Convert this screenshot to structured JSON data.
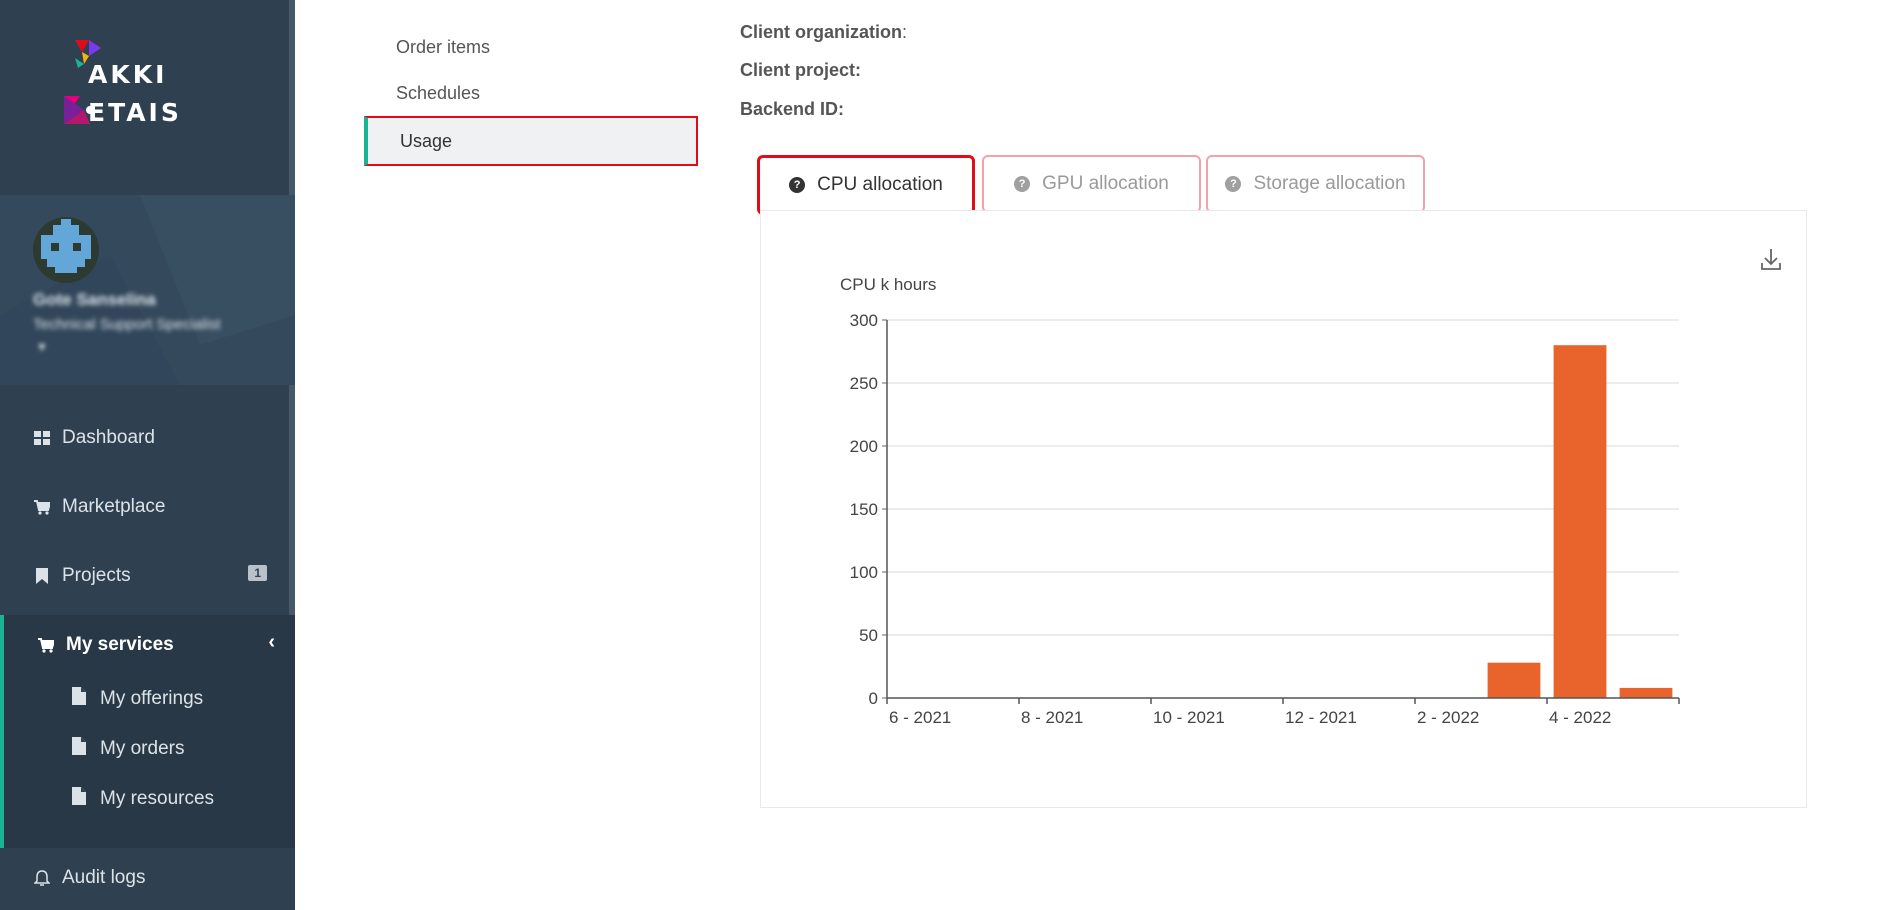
{
  "sidebar": {
    "brand": {
      "line1": "AKKI",
      "line2": "ETAIS"
    },
    "user": {
      "name": "Gote Sanselina",
      "role": "Technical Support Specialist"
    },
    "nav": [
      {
        "label": "Dashboard",
        "icon": "dashboard-icon"
      },
      {
        "label": "Marketplace",
        "icon": "cart-icon"
      },
      {
        "label": "Projects",
        "icon": "bookmark-icon",
        "badge": "1"
      },
      {
        "label": "My services",
        "icon": "cart-icon",
        "chevron": "‹"
      }
    ],
    "subnav": [
      {
        "label": "My offerings",
        "icon": "file-icon"
      },
      {
        "label": "My orders",
        "icon": "file-icon"
      },
      {
        "label": "My resources",
        "icon": "file-icon"
      }
    ],
    "audit": {
      "label": "Audit logs",
      "icon": "bell-icon"
    }
  },
  "details_tabs": [
    {
      "label": "Order items"
    },
    {
      "label": "Schedules"
    },
    {
      "label": "Usage"
    }
  ],
  "info": {
    "client_org": "Client organization",
    "client_project": "Client project:",
    "backend_id": "Backend ID:"
  },
  "usage_tabs": {
    "cpu": "CPU allocation",
    "gpu": "GPU allocation",
    "storage": "Storage allocation"
  },
  "colors": {
    "bar": "#e8642c",
    "accent": "#1ab394",
    "highlight": "#e30b17",
    "sidebar": "#2f4050"
  },
  "chart_data": {
    "type": "bar",
    "ylabel": "CPU k hours",
    "ylim": [
      0,
      300
    ],
    "yticks": [
      0,
      50,
      100,
      150,
      200,
      250,
      300
    ],
    "categories": [
      "6 - 2021",
      "7 - 2021",
      "8 - 2021",
      "9 - 2021",
      "10 - 2021",
      "11 - 2021",
      "12 - 2021",
      "1 - 2022",
      "2 - 2022",
      "3 - 2022",
      "4 - 2022",
      "5 - 2022"
    ],
    "x_tick_labels": [
      "6 - 2021",
      "8 - 2021",
      "10 - 2021",
      "12 - 2021",
      "2 - 2022",
      "4 - 2022"
    ],
    "values": [
      0,
      0,
      0,
      0,
      0,
      0,
      0,
      0,
      0,
      28,
      280,
      8
    ],
    "grid": true,
    "legend": "none"
  }
}
